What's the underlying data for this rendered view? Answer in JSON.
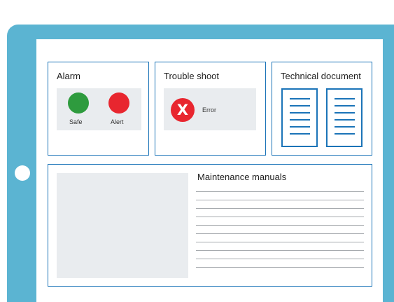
{
  "panels": {
    "alarm": {
      "title": "Alarm",
      "safe_label": "Safe",
      "alert_label": "Alert",
      "safe_color": "#2e9b3e",
      "alert_color": "#e8262f"
    },
    "trouble_shoot": {
      "title": "Trouble shoot",
      "error_label": "Error",
      "error_icon": "x-icon",
      "error_color": "#e8262f"
    },
    "technical_document": {
      "title": "Technical document",
      "icon": "document-icon"
    },
    "maintenance_manuals": {
      "title": "Maintenance manuals"
    }
  },
  "colors": {
    "tablet_frame": "#5bb4d2",
    "accent": "#1b74b8"
  }
}
